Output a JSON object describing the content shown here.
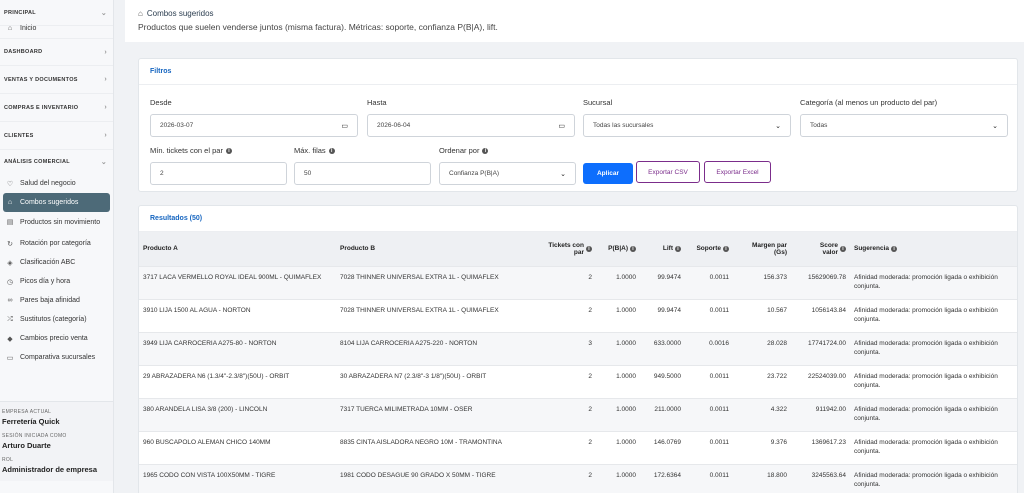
{
  "sidebar": {
    "sections": {
      "principal": "PRINCIPAL",
      "dashboard": "DASHBOARD",
      "ventas": "VENTAS Y DOCUMENTOS",
      "compras": "COMPRAS E INVENTARIO",
      "clientes": "CLIENTES",
      "analisis": "ANÁLISIS COMERCIAL"
    },
    "inicio": "Inicio",
    "items": [
      {
        "label": "Salud del negocio",
        "icon": "heart-icon"
      },
      {
        "label": "Combos sugeridos",
        "icon": "basket-icon",
        "active": true
      },
      {
        "label": "Productos sin movimiento",
        "icon": "box-icon"
      },
      {
        "label": "Rotación por categoría",
        "icon": "rotate-icon"
      },
      {
        "label": "Clasificación ABC",
        "icon": "layers-icon"
      },
      {
        "label": "Picos día y hora",
        "icon": "clock-icon"
      },
      {
        "label": "Pares baja afinidad",
        "icon": "link-icon"
      },
      {
        "label": "Sustitutos (categoría)",
        "icon": "shuffle-icon"
      },
      {
        "label": "Cambios precio venta",
        "icon": "tag-icon"
      },
      {
        "label": "Comparativa sucursales",
        "icon": "store-icon"
      }
    ],
    "footer": {
      "empresa_label": "EMPRESA ACTUAL",
      "empresa": "Ferretería Quick",
      "sesion_label": "SESIÓN INICIADA COMO",
      "usuario": "Arturo Duarte",
      "rol_label": "ROL",
      "rol": "Administrador de empresa"
    }
  },
  "header": {
    "title": "Combos sugeridos",
    "subtitle": "Productos que suelen venderse juntos (misma factura). Métricas: soporte, confianza P(B|A), lift."
  },
  "filters": {
    "title": "Filtros",
    "desde_label": "Desde",
    "desde_value": "2026-03-07",
    "hasta_label": "Hasta",
    "hasta_value": "2026-06-04",
    "sucursal_label": "Sucursal",
    "sucursal_value": "Todas las sucursales",
    "categoria_label": "Categoría (al menos un producto del par)",
    "categoria_value": "Todas",
    "min_tickets_label": "Mín. tickets con el par",
    "min_tickets_value": "2",
    "max_filas_label": "Máx. filas",
    "max_filas_value": "50",
    "ordenar_label": "Ordenar por",
    "ordenar_value": "Confianza P(B|A)",
    "aplicar": "Aplicar",
    "export_csv": "Exportar CSV",
    "export_excel": "Exportar Excel"
  },
  "results": {
    "title": "Resultados (50)",
    "columns": {
      "producto_a": "Producto A",
      "producto_b": "Producto B",
      "tickets": "Tickets con par",
      "pba": "P(B|A)",
      "lift": "Lift",
      "soporte": "Soporte",
      "margen": "Margen par (Gs)",
      "score": "Score valor",
      "sugerencia": "Sugerencia"
    },
    "rows": [
      [
        "3717 LACA VERMELLO ROYAL IDEAL 900ML - QUIMAFLEX",
        "7028 THINNER UNIVERSAL EXTRA 1L - QUIMAFLEX",
        "2",
        "1.0000",
        "99.9474",
        "0.0011",
        "156.373",
        "15629069.78",
        "Afinidad moderada: promoción ligada o exhibición conjunta."
      ],
      [
        "3910 LIJA 1500 AL AGUA - NORTON",
        "7028 THINNER UNIVERSAL EXTRA 1L - QUIMAFLEX",
        "2",
        "1.0000",
        "99.9474",
        "0.0011",
        "10.567",
        "1056143.84",
        "Afinidad moderada: promoción ligada o exhibición conjunta."
      ],
      [
        "3949 LIJA CARROCERIA A275-80 - NORTON",
        "8104 LIJA CARROCERIA A275-220 - NORTON",
        "3",
        "1.0000",
        "633.0000",
        "0.0016",
        "28.028",
        "17741724.00",
        "Afinidad moderada: promoción ligada o exhibición conjunta."
      ],
      [
        "29 ABRAZADERA N6 (1.3/4\"-2.3/8\")(50U) - ORBIT",
        "30 ABRAZADERA N7 (2.3/8\"-3 1/8\")(50U) - ORBIT",
        "2",
        "1.0000",
        "949.5000",
        "0.0011",
        "23.722",
        "22524039.00",
        "Afinidad moderada: promoción ligada o exhibición conjunta."
      ],
      [
        "380 ARANDELA LISA 3/8 (200) - LINCOLN",
        "7317 TUERCA MILIMETRADA 10MM - OSER",
        "2",
        "1.0000",
        "211.0000",
        "0.0011",
        "4.322",
        "911942.00",
        "Afinidad moderada: promoción ligada o exhibición conjunta."
      ],
      [
        "960 BUSCAPOLO ALEMAN CHICO 140MM",
        "8835 CINTA AISLADORA NEGRO 10M - TRAMONTINA",
        "2",
        "1.0000",
        "146.0769",
        "0.0011",
        "9.376",
        "1369617.23",
        "Afinidad moderada: promoción ligada o exhibición conjunta."
      ],
      [
        "1965 CODO CON VISTA 100X50MM - TIGRE",
        "1981 CODO DESAGUE 90 GRADO X 50MM - TIGRE",
        "2",
        "1.0000",
        "172.6364",
        "0.0011",
        "18.800",
        "3245563.64",
        "Afinidad moderada: promoción ligada o exhibición conjunta."
      ]
    ]
  }
}
